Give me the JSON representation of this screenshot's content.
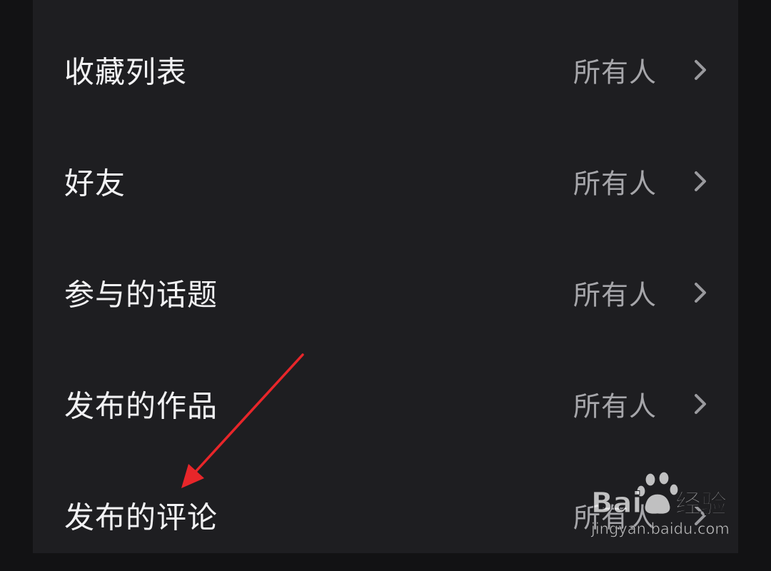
{
  "privacy_settings": {
    "items": [
      {
        "label": "收藏列表",
        "value": "所有人",
        "icon": "chevron-right-icon"
      },
      {
        "label": "好友",
        "value": "所有人",
        "icon": "chevron-right-icon"
      },
      {
        "label": "参与的话题",
        "value": "所有人",
        "icon": "chevron-right-icon"
      },
      {
        "label": "发布的作品",
        "value": "所有人",
        "icon": "chevron-right-icon"
      },
      {
        "label": "发布的评论",
        "value": "所有人",
        "icon": "chevron-right-icon"
      }
    ]
  },
  "annotation": {
    "arrow_color": "#e8262a"
  },
  "watermark": {
    "brand": "Baidu经验",
    "url": "jingyan.baidu.com"
  },
  "colors": {
    "background": "#121214",
    "panel": "#1e1e21",
    "label_text": "#f2f2f4",
    "value_text": "#a6a6aa",
    "chevron": "#9a9a9e"
  }
}
